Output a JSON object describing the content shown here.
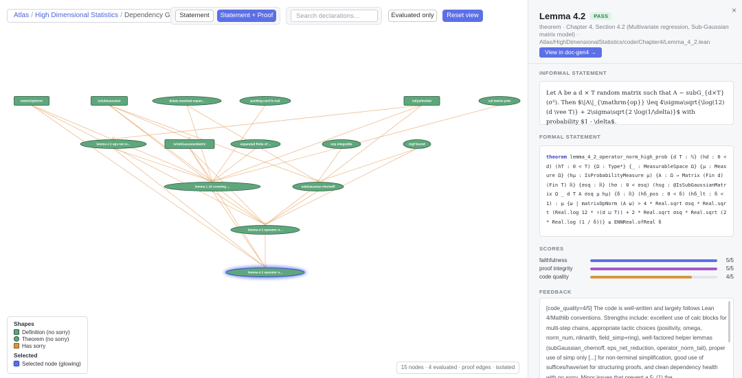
{
  "toolbar": {
    "breadcrumb": {
      "root": "Atlas",
      "sep": "/",
      "book": "High Dimensional Statistics",
      "current": "Dependency Graph"
    },
    "mode_statement": "Statement",
    "mode_statement_proof": "Statement + Proof",
    "search_placeholder": "Search declarations...",
    "evaluated_only": "Evaluated only",
    "reset_view": "Reset view"
  },
  "graph": {
    "nodes": [
      {
        "id": "matrixOpNorm",
        "label": "matrixOpNorm",
        "kind": "definition"
      },
      {
        "id": "IsSubGaussian",
        "label": "IsSubGaussian",
        "kind": "definition"
      },
      {
        "id": "delta_maximal",
        "label": "delata maximal expan...",
        "kind": "theorem"
      },
      {
        "id": "packing_card",
        "label": "packing card le real",
        "kind": "theorem"
      },
      {
        "id": "IsEpsilonNet",
        "label": "IsEpsilonNet",
        "kind": "definition"
      },
      {
        "id": "cal_twelve_pow",
        "label": "cal twelve pow",
        "kind": "theorem"
      },
      {
        "id": "lemma_4_2_eps",
        "label": "lemma 4 2 eps net re...",
        "kind": "theorem"
      },
      {
        "id": "IsSubGaussianMatrix",
        "label": "IsSubGaussianMatrix",
        "kind": "definition"
      },
      {
        "id": "separated_finite",
        "label": "separated finite of ...",
        "kind": "theorem"
      },
      {
        "id": "exp_integrable",
        "label": "exp integrable",
        "kind": "theorem"
      },
      {
        "id": "mgf_bound",
        "label": "mgf bound",
        "kind": "theorem"
      },
      {
        "id": "lemma_1_16",
        "label": "lemma 1 16 covering ...",
        "kind": "theorem"
      },
      {
        "id": "subGaussian_chernoff",
        "label": "subGaussian chernoff",
        "kind": "theorem"
      },
      {
        "id": "lemma_4_2_op",
        "label": "lemma 4 2 operator n...",
        "kind": "theorem"
      },
      {
        "id": "lemma_4_2_op_high",
        "label": "lemma 4 2 operator n...",
        "kind": "theorem",
        "selected": true
      }
    ],
    "edges": [
      [
        "matrixOpNorm",
        "lemma_4_2_op_high"
      ],
      [
        "matrixOpNorm",
        "lemma_4_2_op"
      ],
      [
        "matrixOpNorm",
        "lemma_1_16"
      ],
      [
        "IsSubGaussian",
        "IsSubGaussianMatrix"
      ],
      [
        "IsSubGaussian",
        "subGaussian_chernoff"
      ],
      [
        "IsSubGaussian",
        "lemma_4_2_op"
      ],
      [
        "IsSubGaussian",
        "lemma_1_16"
      ],
      [
        "delta_maximal",
        "lemma_1_16"
      ],
      [
        "delta_maximal",
        "subGaussian_chernoff"
      ],
      [
        "packing_card",
        "lemma_1_16"
      ],
      [
        "IsEpsilonNet",
        "lemma_4_2_eps"
      ],
      [
        "IsEpsilonNet",
        "lemma_1_16"
      ],
      [
        "IsEpsilonNet",
        "lemma_4_2_op"
      ],
      [
        "cal_twelve_pow",
        "lemma_1_16"
      ],
      [
        "lemma_4_2_eps",
        "lemma_4_2_op_high"
      ],
      [
        "lemma_4_2_eps",
        "lemma_1_16"
      ],
      [
        "IsSubGaussianMatrix",
        "lemma_4_2_op"
      ],
      [
        "IsSubGaussianMatrix",
        "lemma_4_2_op_high"
      ],
      [
        "IsSubGaussianMatrix",
        "lemma_1_16"
      ],
      [
        "separated_finite",
        "lemma_1_16"
      ],
      [
        "exp_integrable",
        "subGaussian_chernoff"
      ],
      [
        "mgf_bound",
        "subGaussian_chernoff"
      ],
      [
        "mgf_bound",
        "lemma_4_2_op"
      ],
      [
        "lemma_1_16",
        "lemma_4_2_op"
      ],
      [
        "lemma_1_16",
        "lemma_4_2_op_high"
      ],
      [
        "subGaussian_chernoff",
        "lemma_4_2_op"
      ],
      [
        "lemma_4_2_op",
        "lemma_4_2_op_high"
      ]
    ],
    "colors": {
      "definition_fill": "#5ea77c",
      "theorem_fill": "#5ea77c",
      "has_sorry_fill": "#d9943f",
      "edge": "#eab27a",
      "selected_glow": "#6c7cf0"
    }
  },
  "legend": {
    "shapes_title": "Shapes",
    "definition": "Definition (no sorry)",
    "theorem": "Theorem (no sorry)",
    "has_sorry": "Has sorry",
    "selected_title": "Selected",
    "selected_node": "Selected node (glowing)"
  },
  "status": "15 nodes · 4 evaluated · proof edges · isolated",
  "panel": {
    "close": "×",
    "title": "Lemma 4.2",
    "badge": "PASS",
    "meta": "theorem · Chapter 4, Section 4.2 (Multivariate regression, Sub-Gaussian matrix model) · Atlas/HighDimensionalStatistics/code/Chapter4/Lemma_4_2.lean",
    "doc_button": "View in doc-gen4 →",
    "informal_heading": "INFORMAL STATEMENT",
    "informal_text": "Let A be a d × T random matrix such that A ∼ subG_{d×T}(σ²). Then $\\|A\\|_{\\mathrm{op}} \\leq 4\\sigma\\sqrt{\\log(12)(d \\vee T)} + 2\\sigma\\sqrt{2 \\log(1/\\delta)}$ with probability $1 - \\delta$.",
    "formal_heading": "FORMAL STATEMENT",
    "formal_keyword": "theorem",
    "formal_text": " lemma_4_2_operator_norm_high_prob {d T : ℕ} (hd : 0 < d) (hT : 0 < T) {Ω : Type*} {_ : MeasurableSpace Ω} {μ : Measure Ω} (hμ : IsProbabilityMeasure μ) {A : Ω → Matrix (Fin d) (Fin T) ℝ} {σsq : ℝ} (hσ : 0 < σsq) (hsg : @IsSubGaussianMatrix Ω _ d T A σsq μ hμ) {δ : ℝ} (hδ_pos : 0 < δ) (hδ_lt : δ < 1) : μ {ω | matrixOpNorm (A ω) > 4 * Real.sqrt σsq * Real.sqrt (Real.log 12 * ↑(d ⊔ T)) + 2 * Real.sqrt σsq * Real.sqrt (2 * Real.log (1 / δ))} ≤ ENNReal.ofReal δ",
    "scores_heading": "SCORES",
    "scores": [
      {
        "name": "faithfulness",
        "value": 5,
        "max": 5,
        "display": "5/5",
        "color": "#5c70e6"
      },
      {
        "name": "proof integrity",
        "value": 5,
        "max": 5,
        "display": "5/5",
        "color": "#a857c9"
      },
      {
        "name": "code quality",
        "value": 4,
        "max": 5,
        "display": "4/5",
        "color": "#d9943f"
      }
    ],
    "feedback_heading": "FEEDBACK",
    "feedback_text": "[code_quality=4/5] The code is well-written and largely follows Lean 4/Mathlib conventions. Strengths include: excellent use of calc blocks for multi-step chains, appropriate tactic choices (positivity, omega, norm_num, nlinarith, field_simp+ring), well-factored helper lemmas (subGaussian_chernoff, eps_net_reduction, operator_norm_tail), proper use of simp only [...] for non-terminal simplification, good use of suffices/have/set for structuring proofs, and clean dependency health with no sorry. Minor issues that prevent a 5: (1) the"
  }
}
